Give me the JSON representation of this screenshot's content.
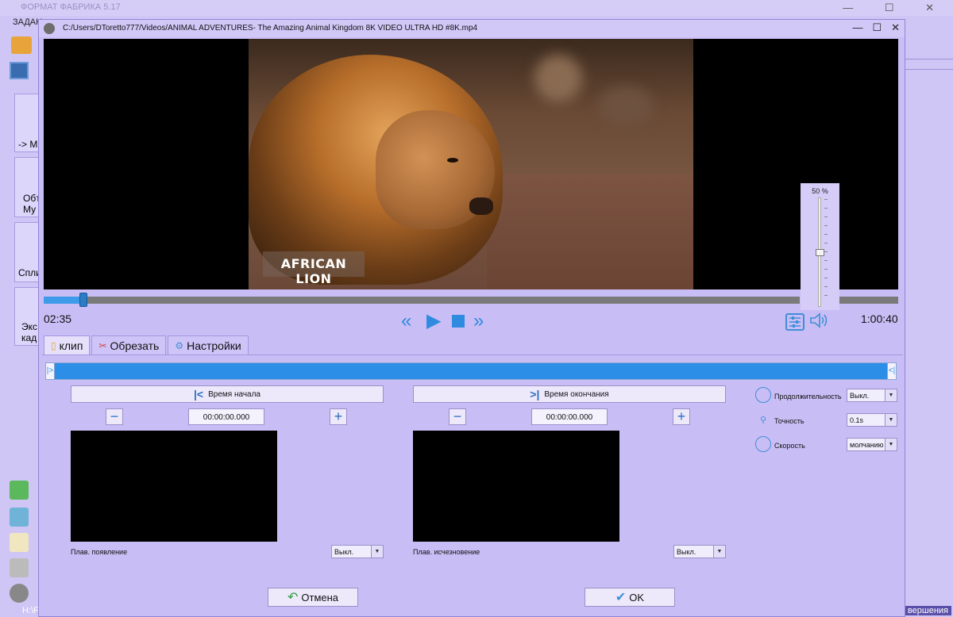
{
  "background_app": {
    "title": "ФОРМАТ ФАБРИКА 5.17",
    "menu": "ЗАДАН",
    "tile_labels": [
      "-> M",
      "Обт Му",
      "Спли",
      "Экс кад"
    ],
    "status_left": "H:\\FI",
    "status_right": "вершения"
  },
  "dialog": {
    "title": "C:/Users/DToretto777/Videos/ANIMAL ADVENTURES- The Amazing Animal Kingdom 8K VIDEO ULTRA HD #8K.mp4",
    "controls": {
      "minimize": "—",
      "maximize": "☐",
      "close": "✕"
    }
  },
  "player": {
    "caption": "AFRICAN LION",
    "volume_label": "50 %",
    "volume_level": 0.5,
    "progress_fraction": 0.052,
    "time_current": "02:35",
    "time_total": "1:00:40"
  },
  "tabs": [
    {
      "label": "клип",
      "icon": "clip-icon",
      "active": true
    },
    {
      "label": "Обрезать",
      "icon": "crop-icon",
      "active": false
    },
    {
      "label": "Настройки",
      "icon": "gear-icon",
      "active": false
    }
  ],
  "clip": {
    "range_left_marker": "|>",
    "range_right_marker": "<|",
    "start": {
      "button_label": "Время начала",
      "time_value": "00:00:00.000",
      "fade_label": "Плав. появление",
      "fade_value": "Выкл."
    },
    "end": {
      "button_label": "Время окончания",
      "time_value": "00:00:00.000",
      "fade_label": "Плав. исчезновение",
      "fade_value": "Выкл."
    },
    "minus": "−",
    "plus": "+",
    "side": [
      {
        "label": "Продолжительность",
        "value": "Выкл.",
        "icon": "clock-icon"
      },
      {
        "label": "Точность",
        "value": "0.1s",
        "icon": "pin-icon"
      },
      {
        "label": "Скорость",
        "value": "молчанию",
        "icon": "speed-icon"
      }
    ],
    "cancel_label": "Отмена",
    "ok_label": "OK"
  }
}
